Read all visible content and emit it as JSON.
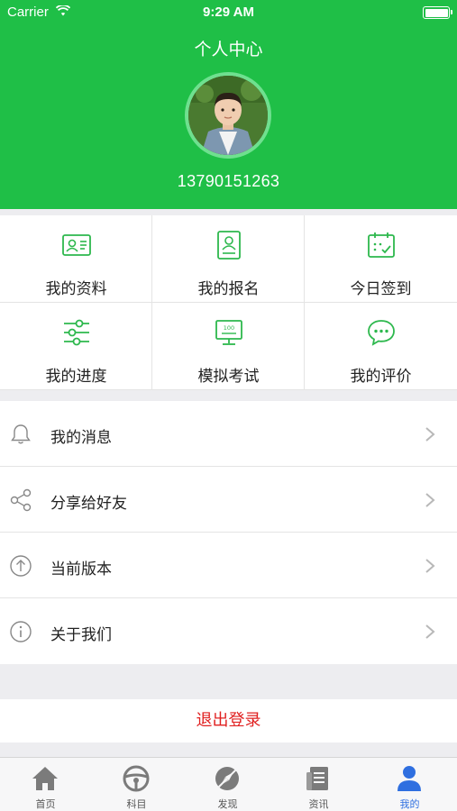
{
  "status_bar": {
    "carrier": "Carrier",
    "time": "9:29 AM"
  },
  "header": {
    "title": "个人中心",
    "phone": "13790151263"
  },
  "grid": [
    {
      "label": "我的资料",
      "icon": "profile-card-icon"
    },
    {
      "label": "我的报名",
      "icon": "registration-icon"
    },
    {
      "label": "今日签到",
      "icon": "calendar-check-icon"
    },
    {
      "label": "我的进度",
      "icon": "sliders-icon"
    },
    {
      "label": "模拟考试",
      "icon": "monitor-exam-icon"
    },
    {
      "label": "我的评价",
      "icon": "comment-icon"
    }
  ],
  "list": [
    {
      "label": "我的消息",
      "icon": "bell-icon"
    },
    {
      "label": "分享给好友",
      "icon": "share-icon"
    },
    {
      "label": "当前版本",
      "icon": "upload-circle-icon"
    },
    {
      "label": "关于我们",
      "icon": "info-icon"
    }
  ],
  "logout_label": "退出登录",
  "tabs": [
    {
      "label": "首页",
      "icon": "home-icon"
    },
    {
      "label": "科目",
      "icon": "steering-wheel-icon"
    },
    {
      "label": "发现",
      "icon": "discover-icon"
    },
    {
      "label": "资讯",
      "icon": "news-icon"
    },
    {
      "label": "我的",
      "icon": "person-icon",
      "active": true
    }
  ],
  "colors": {
    "brand_green": "#1fbf47",
    "icon_green": "#2db84d",
    "logout_red": "#e02020",
    "active_tab_blue": "#2f6fe0"
  }
}
